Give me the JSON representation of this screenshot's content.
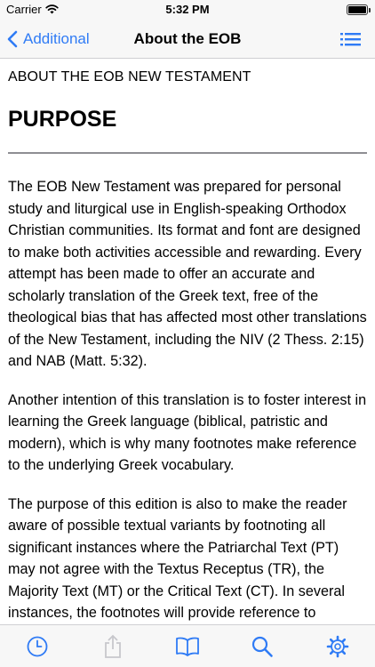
{
  "status": {
    "carrier": "Carrier",
    "time": "5:32 PM",
    "battery_level": 1.0
  },
  "nav": {
    "back_label": "Additional",
    "title": "About the EOB"
  },
  "content": {
    "heading": "ABOUT THE EOB NEW TESTAMENT",
    "title": "PURPOSE",
    "paragraphs": [
      "The EOB New Testament was prepared for personal study and liturgical use in English-speaking Orthodox Christian communities. Its format and font are designed to make both activities accessible and rewarding. Every attempt has been made to offer an accurate and scholarly translation of the Greek text, free of the theological bias that has affected most other translations of the New Testament, including the NIV (2 Thess. 2:15) and NAB (Matt. 5:32).",
      "Another intention of this translation is to foster interest in learning the Greek language (biblical, patristic and modern), which is why many footnotes make reference to the underlying Greek vocabulary.",
      "The purpose of this edition is also to make the reader aware of possible textual variants by footnoting all significant instances where the Patriarchal Text (PT) may not agree with the Textus Receptus (TR), the Majority Text (MT) or the Critical Text (CT). In several instances, the footnotes will provide reference to specific manuscripts."
    ]
  },
  "tabs": [
    {
      "icon": "clock-icon",
      "active": true
    },
    {
      "icon": "share-icon",
      "active": false
    },
    {
      "icon": "book-icon",
      "active": true
    },
    {
      "icon": "search-icon",
      "active": true
    },
    {
      "icon": "gear-icon",
      "active": true
    }
  ],
  "colors": {
    "accent": "#2f7bf5",
    "disabled": "#c7c7cc",
    "bar_background": "#f7f7f7"
  }
}
